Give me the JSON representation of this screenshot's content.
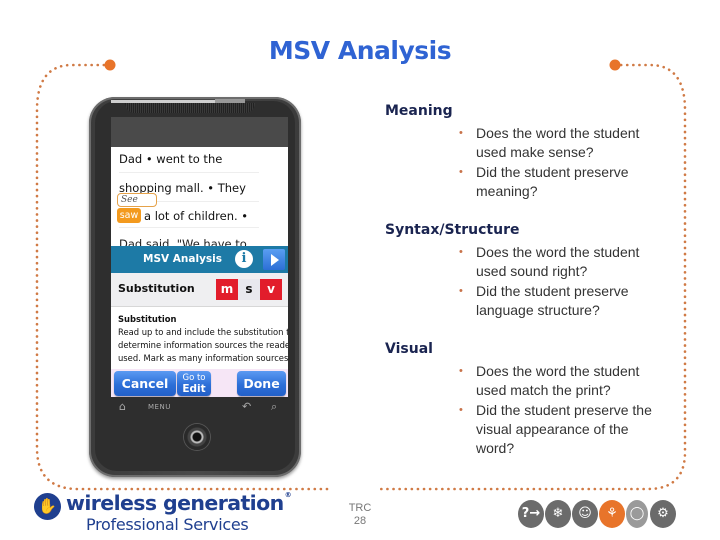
{
  "slide": {
    "title": "MSV Analysis",
    "accent_color": "#e8742a",
    "title_color": "#2f63d3"
  },
  "phone": {
    "story_lines": [
      "Dad • went to the",
      "shopping mall. • They",
      "a lot of children. •"
    ],
    "handwritten_note": "See",
    "highlighted_word": "saw",
    "partially_hidden_line": "Dad said, \"We have to",
    "panel_title": "MSV Analysis",
    "info_icon": "info-icon",
    "next_icon": "play-arrow-icon",
    "error_type": "Substitution",
    "msv_buttons": [
      {
        "letter": "m",
        "selected": true
      },
      {
        "letter": "s",
        "selected": false
      },
      {
        "letter": "v",
        "selected": true
      }
    ],
    "description_heading": "Substitution",
    "description_lines": [
      "Read up to and include the substitution to",
      "determine information sources the reader",
      "used. Mark as many information sources as"
    ],
    "buttons": {
      "cancel": "Cancel",
      "go_to_edit_line1": "Go to",
      "go_to_edit_line2": "Edit",
      "done": "Done"
    },
    "nav": {
      "home_icon": "⌂",
      "menu": "MENU",
      "back_icon": "↶",
      "search_icon": "⌕"
    }
  },
  "sections": [
    {
      "heading": "Meaning",
      "bullets": [
        "Does the word the student used make sense?",
        "Did the student preserve meaning?"
      ]
    },
    {
      "heading": "Syntax/Structure",
      "bullets": [
        "Does the word the student used sound right?",
        "Did the student preserve language structure?"
      ]
    },
    {
      "heading": "Visual",
      "bullets": [
        "Does the word the student used match the print?",
        "Did the student preserve the visual appearance of the word?"
      ]
    }
  ],
  "footer": {
    "logo_main": "wireless generation",
    "logo_reg": "®",
    "logo_sub": "Professional Services",
    "label": "TRC",
    "page_number": "28",
    "strategy_icons": [
      {
        "name": "question-arrow-icon",
        "glyph": "?→",
        "color": "#6b6b6b"
      },
      {
        "name": "snowflake-icon",
        "glyph": "❄",
        "color": "#6b6b6b"
      },
      {
        "name": "magnifier-face-icon",
        "glyph": "☺",
        "color": "#6b6b6b"
      },
      {
        "name": "bicycle-icon",
        "glyph": "⚘",
        "color": "#e8742a"
      },
      {
        "name": "egg-face-icon",
        "glyph": "◯",
        "color": "#9a9a9a"
      },
      {
        "name": "gears-icon",
        "glyph": "⚙",
        "color": "#6b6b6b"
      }
    ]
  }
}
